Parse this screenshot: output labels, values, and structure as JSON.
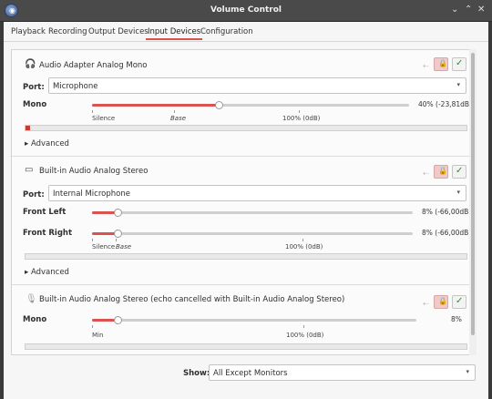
{
  "window": {
    "title": "Volume Control"
  },
  "tabs": [
    {
      "label": "Playback"
    },
    {
      "label": "Recording"
    },
    {
      "label": "Output Devices"
    },
    {
      "label": "Input Devices",
      "active": true
    },
    {
      "label": "Configuration"
    }
  ],
  "devices": [
    {
      "name": "Audio Adapter Analog Mono",
      "icon": "headphones-icon",
      "port_label": "Port:",
      "port_value": "Microphone",
      "channels": [
        {
          "label": "Mono",
          "value_text": "40% (-23,81dB)",
          "level": 0.4
        }
      ],
      "scale": {
        "left": "Silence",
        "mid": "Base",
        "right": "100% (0dB)"
      },
      "meter_level": 0.01,
      "advanced_label": "Advanced"
    },
    {
      "name": "Built-in Audio Analog Stereo",
      "icon": "monitor-icon",
      "port_label": "Port:",
      "port_value": "Internal Microphone",
      "channels": [
        {
          "label": "Front Left",
          "value_text": "8% (-66,00dB)",
          "level": 0.08
        },
        {
          "label": "Front Right",
          "value_text": "8% (-66,00dB)",
          "level": 0.08
        }
      ],
      "scale": {
        "left": "Silence",
        "mid": "Base",
        "right": "100% (0dB)"
      },
      "meter_level": 0.0,
      "advanced_label": "Advanced"
    },
    {
      "name": "Built-in Audio Analog Stereo (echo cancelled with Built-in Audio Analog Stereo)",
      "icon": "microphone-icon",
      "channels": [
        {
          "label": "Mono",
          "value_text": "8%",
          "level": 0.08
        }
      ],
      "scale": {
        "left": "Min",
        "right": "100% (0dB)"
      },
      "meter_level": 0.0
    }
  ],
  "footer": {
    "show_label": "Show:",
    "show_value": "All Except Monitors"
  },
  "colors": {
    "accent": "#d9534f",
    "default_check": "#2e8b3a"
  }
}
